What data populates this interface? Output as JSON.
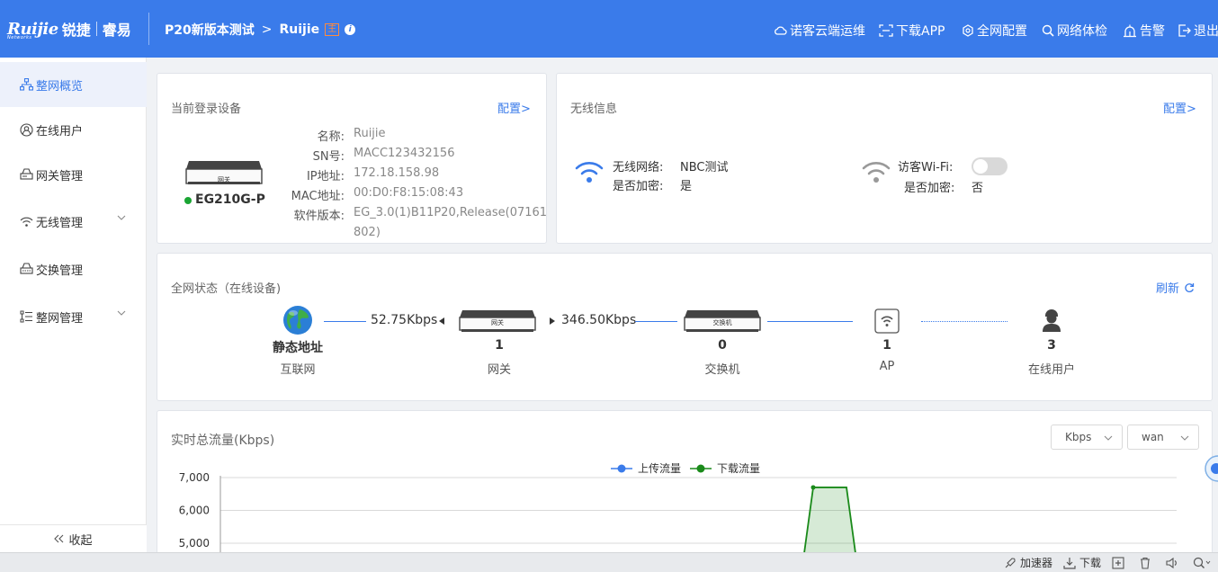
{
  "header": {
    "logo_brand": "Ruijie",
    "logo_brand_cn": "锐捷",
    "logo_sub": "睿易",
    "logo_tag": "Networks",
    "breadcrumb_project": "P20新版本测试",
    "breadcrumb_arrow": ">",
    "breadcrumb_device": "Ruijie",
    "breadcrumb_tag": "主",
    "info_icon": "i",
    "nav": [
      {
        "label": "诺客云端运维",
        "icon": "cloud-icon"
      },
      {
        "label": "下载APP",
        "icon": "download-app-icon"
      },
      {
        "label": "全网配置",
        "icon": "network-config-icon"
      },
      {
        "label": "网络体检",
        "icon": "network-check-icon"
      },
      {
        "label": "告警",
        "icon": "alarm-icon"
      },
      {
        "label": "退出",
        "icon": "logout-icon"
      }
    ]
  },
  "sidebar": {
    "items": [
      {
        "label": "整网概览",
        "icon": "topology-icon",
        "active": true
      },
      {
        "label": "在线用户",
        "icon": "user-icon"
      },
      {
        "label": "网关管理",
        "icon": "gateway-icon"
      },
      {
        "label": "无线管理",
        "icon": "wifi-icon",
        "expandable": true
      },
      {
        "label": "交换管理",
        "icon": "switch-icon"
      },
      {
        "label": "整网管理",
        "icon": "network-manage-icon",
        "expandable": true
      }
    ],
    "collapse_label": "收起"
  },
  "device_card": {
    "title": "当前登录设备",
    "config_link": "配置>",
    "device_image_text": "网关",
    "model": "EG210G-P",
    "status_color": "#1aa533",
    "fields": [
      {
        "label": "名称:",
        "value": "Ruijie"
      },
      {
        "label": "SN号:",
        "value": "MACC123432156"
      },
      {
        "label": "IP地址:",
        "value": "172.18.158.98"
      },
      {
        "label": "MAC地址:",
        "value": "00:D0:F8:15:08:43"
      },
      {
        "label": "软件版本:",
        "value": "EG_3.0(1)B11P20,Release(07161",
        "value_cont": "802)"
      }
    ]
  },
  "wireless_card": {
    "title": "无线信息",
    "config_link": "配置>",
    "network_label": "无线网络:",
    "network_value": "NBC测试",
    "encrypt_label": "是否加密:",
    "encrypt_value": "是",
    "guest_label": "访客Wi-Fi:",
    "guest_encrypt_label": "是否加密:",
    "guest_encrypt_value": "否",
    "guest_enabled": false
  },
  "topology_card": {
    "title": "全网状态（在线设备)",
    "refresh_label": "刷新",
    "upload_rate": "52.75Kbps",
    "download_rate": "346.50Kbps",
    "nodes": [
      {
        "value": "静态地址",
        "label": "互联网",
        "icon": "globe-icon"
      },
      {
        "value": "1",
        "label": "网关",
        "icon": "gateway-device-icon",
        "image_text": "网关"
      },
      {
        "value": "0",
        "label": "交换机",
        "icon": "switch-device-icon",
        "image_text": "交换机"
      },
      {
        "value": "1",
        "label": "AP",
        "icon": "ap-icon"
      },
      {
        "value": "3",
        "label": "在线用户",
        "icon": "person-icon"
      }
    ]
  },
  "traffic_card": {
    "title": "实时总流量(Kbps)",
    "unit_select": "Kbps",
    "interface_select": "wan"
  },
  "chart_data": {
    "type": "area",
    "title": "实时总流量(Kbps)",
    "series": [
      {
        "name": "上传流量",
        "color": "#3a7bea",
        "values": []
      },
      {
        "name": "下载流量",
        "color": "#1a8a1a",
        "values": [
          0,
          6700,
          6700,
          0
        ]
      }
    ],
    "y_ticks": [
      "7,000",
      "6,000",
      "5,000"
    ],
    "ylim": [
      4700,
      7000
    ],
    "legend": "top-center",
    "grid": true
  },
  "statusbar": {
    "items": [
      {
        "label": "加速器",
        "icon": "rocket-icon"
      },
      {
        "label": "下载",
        "icon": "download-icon"
      },
      {
        "label": "",
        "icon": "plus-box-icon"
      },
      {
        "label": "",
        "icon": "trash-icon"
      },
      {
        "label": "",
        "icon": "speaker-icon"
      },
      {
        "label": "",
        "icon": "zoom-icon"
      }
    ]
  }
}
